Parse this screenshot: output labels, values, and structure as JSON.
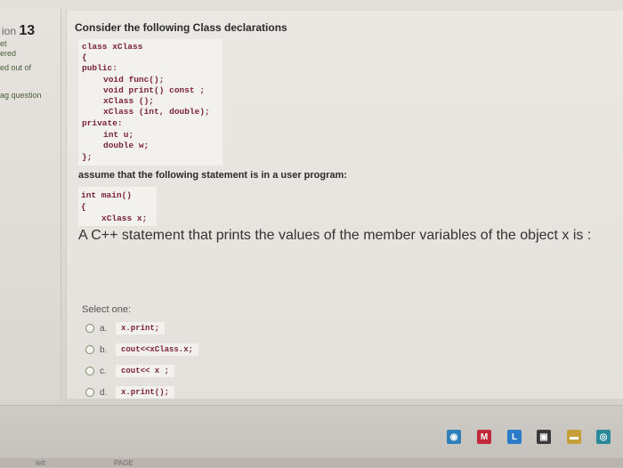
{
  "sidebar": {
    "question_prefix": "ion",
    "question_number": "13",
    "lines": [
      "et",
      "ered",
      "ed out of",
      "ag question"
    ]
  },
  "question": {
    "heading": "Consider the following Class declarations",
    "class_code": [
      "class xClass",
      "{",
      "public:",
      "void func();",
      "void print() const ;",
      "xClass ();",
      "xClass (int, double);",
      "private:",
      "int u;",
      "double w;",
      "};"
    ],
    "statement": "assume that the following statement is in a user program:",
    "main_code": [
      "int main()",
      "{",
      "xClass x;"
    ],
    "prompt": "A C++ statement that prints the values of the member variables of the object x is :",
    "select_label": "Select one:",
    "options": [
      {
        "letter": "a.",
        "code": "x.print;"
      },
      {
        "letter": "b.",
        "code": "cout<<xClass.x;"
      },
      {
        "letter": "c.",
        "code": "cout<< x ;"
      },
      {
        "letter": "d.",
        "code": "x.print();"
      }
    ]
  },
  "taskbar": {
    "icons": [
      {
        "name": "store-icon",
        "glyph": "◉",
        "color": "#2f7fb8"
      },
      {
        "name": "mail-icon",
        "glyph": "M",
        "color": "#c02a3a"
      },
      {
        "name": "launcher-icon",
        "glyph": "L",
        "color": "#2a7cc7"
      },
      {
        "name": "bag-icon",
        "glyph": "▣",
        "color": "#3a3a3a"
      },
      {
        "name": "folder-icon",
        "glyph": "▬",
        "color": "#c7a03a"
      },
      {
        "name": "chrome-icon",
        "glyph": "◎",
        "color": "#2a8a9a"
      }
    ],
    "bottom_left": "lett",
    "bottom_mid": "PAGE"
  }
}
